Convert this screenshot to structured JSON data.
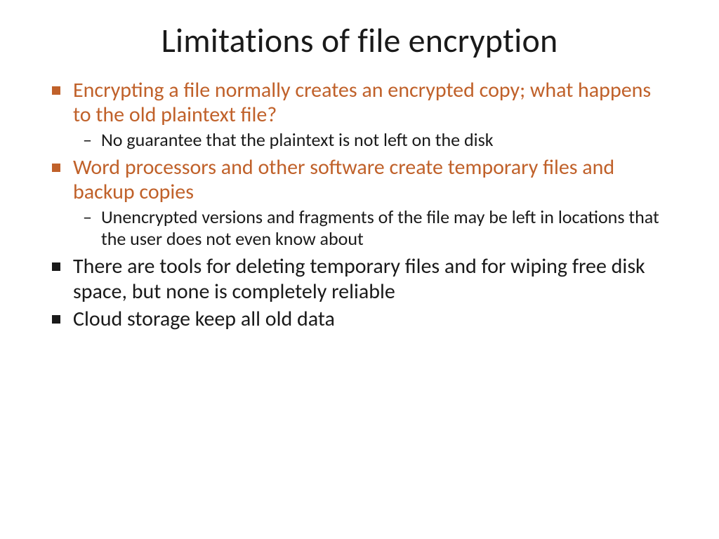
{
  "slide": {
    "title": "Limitations of file encryption",
    "bullets": [
      {
        "style": "orange",
        "text": "Encrypting a file normally creates an encrypted copy; what happens to the old plaintext file?",
        "sub": [
          "No guarantee that the plaintext is not left on the disk"
        ]
      },
      {
        "style": "orange",
        "text": "Word processors and other software create temporary files and backup copies",
        "sub": [
          "Unencrypted versions and fragments of the file may be left in locations that the user does not even know about"
        ]
      },
      {
        "style": "black",
        "text": "There are tools for deleting temporary files and for wiping free disk space, but none is completely reliable",
        "sub": []
      },
      {
        "style": "black",
        "text": "Cloud storage keep all old data",
        "sub": []
      }
    ]
  }
}
